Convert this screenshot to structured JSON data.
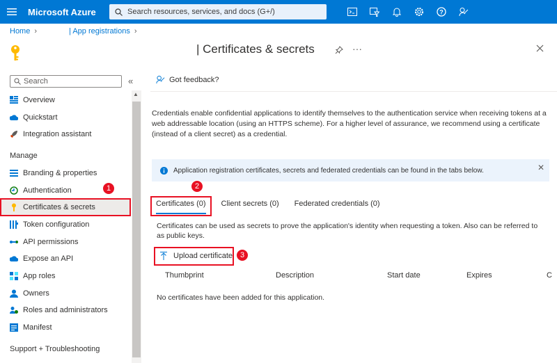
{
  "topbar": {
    "brand": "Microsoft Azure",
    "search_placeholder": "Search resources, services, and docs (G+/)",
    "icons": [
      "cloud-shell-icon",
      "directory-filter-icon",
      "notifications-icon",
      "settings-icon",
      "help-icon",
      "feedback-icon"
    ]
  },
  "breadcrumb": {
    "home": "Home",
    "app_registrations": "| App registrations"
  },
  "page": {
    "title": "| Certificates & secrets",
    "more": "···"
  },
  "sidebar": {
    "search_placeholder": "Search",
    "collapse": "«",
    "items_top": [
      {
        "label": "Overview",
        "icon": "overview-icon"
      },
      {
        "label": "Quickstart",
        "icon": "quickstart-icon"
      },
      {
        "label": "Integration assistant",
        "icon": "rocket-icon"
      }
    ],
    "manage_heading": "Manage",
    "manage_items": [
      {
        "label": "Branding & properties",
        "icon": "branding-icon"
      },
      {
        "label": "Authentication",
        "icon": "authentication-icon"
      },
      {
        "label": "Certificates & secrets",
        "icon": "key-icon"
      },
      {
        "label": "Token configuration",
        "icon": "token-icon"
      },
      {
        "label": "API permissions",
        "icon": "api-permissions-icon"
      },
      {
        "label": "Expose an API",
        "icon": "cloud-icon"
      },
      {
        "label": "App roles",
        "icon": "app-roles-icon"
      },
      {
        "label": "Owners",
        "icon": "owners-icon"
      },
      {
        "label": "Roles and administrators",
        "icon": "roles-icon"
      },
      {
        "label": "Manifest",
        "icon": "manifest-icon"
      }
    ],
    "support_heading": "Support + Troubleshooting"
  },
  "main": {
    "feedback": "Got feedback?",
    "description": "Credentials enable confidential applications to identify themselves to the authentication service when receiving tokens at a web addressable location (using an HTTPS scheme). For a higher level of assurance, we recommend using a certificate (instead of a client secret) as a credential.",
    "info": "Application registration certificates, secrets and federated credentials can be found in the tabs below.",
    "tabs": [
      "Certificates (0)",
      "Client secrets (0)",
      "Federated credentials (0)"
    ],
    "tab_description": "Certificates can be used as secrets to prove the application's identity when requesting a token. Also can be referred to as public keys.",
    "upload": "Upload certificate",
    "columns": [
      "Thumbprint",
      "Description",
      "Start date",
      "Expires",
      "C"
    ],
    "empty": "No certificates have been added for this application."
  },
  "callouts": [
    "1",
    "2",
    "3"
  ],
  "colors": {
    "azure_blue": "#0078d4",
    "callout_red": "#e81123"
  }
}
